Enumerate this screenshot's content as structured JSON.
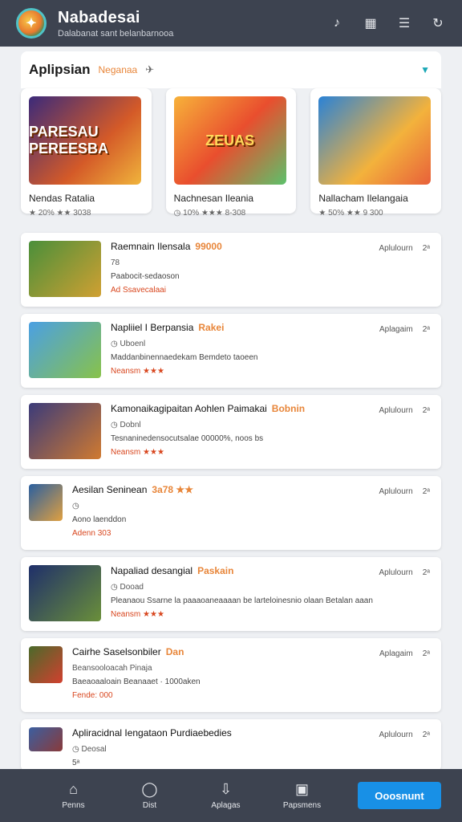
{
  "header": {
    "title": "Nabadesai",
    "subtitle": "Dalabanat sant belanbarnooa",
    "icons": [
      "bell-icon",
      "bookmark-icon",
      "list-icon",
      "refresh-icon"
    ]
  },
  "featured": {
    "title": "Aplipsian",
    "tag": "Neganaa",
    "cards": [
      {
        "art": "PARESAU PEREESBA",
        "name": "Nendas Ratalia",
        "meta": "★ 20% ★★ 3038"
      },
      {
        "art": "ZEUAS",
        "name": "Nachnesan Ileania",
        "meta": "◷ 10% ★★★ 8-308"
      },
      {
        "art": "",
        "name": "Nallacham Ilelangaia",
        "meta": "★ 50% ★★ 9 300"
      }
    ]
  },
  "list": [
    {
      "name": "Raemnain Ilensala",
      "tag": "99000",
      "sub": "78",
      "desc": "Paabocit-sedaoson",
      "rating": "Ad Ssavecalaai",
      "right": "Aplulourn",
      "right2": "2ᵃ"
    },
    {
      "name": "Napliiel I Berpansia",
      "tag": "Rakei",
      "sub": "◷ Uboenl",
      "desc": "Maddanbinennaedekam Bemdeto taoeen",
      "rating": "Neansm ★★★",
      "right": "Aplagaim",
      "right2": "2ᵃ"
    },
    {
      "name": "Kamonaikagipaitan Aohlen Paimakai",
      "tag": "Bobnin",
      "sub": "◷ Dobnl",
      "desc": "Tesnaninedensocutsalae 00000%, noos bs",
      "rating": "Neansm ★★★",
      "right": "Aplulourn",
      "right2": "2ᵃ"
    },
    {
      "name": "Aesilan Seninean",
      "tag": "3a78 ★★",
      "sub": "◷",
      "desc": "Aono laenddon",
      "rating": "Adenn 303",
      "right": "Aplulourn",
      "right2": "2ᵃ"
    },
    {
      "name": "Napaliad desangial",
      "tag": "Paskain",
      "sub": "◷ Dooad",
      "desc": "Pleanaou Ssarne la paaaoaneaaaan be larteloinesnio olaan Betalan aaan",
      "rating": "Neansm ★★★",
      "right": "Aplulourn",
      "right2": "2ᵃ"
    },
    {
      "name": "Cairhe Saselsonbiler",
      "tag": "Dan",
      "sub": "Beansooloacah Pinaja",
      "desc": "Baeaoaaloain Beanaaet · 1000aken",
      "rating": "Fende: 000",
      "right": "Aplagaim",
      "right2": "2ᵃ"
    },
    {
      "name": "Apliracidnal Iengataon Purdiaebedies",
      "tag": "",
      "sub": "◷ Deosal",
      "desc": "5ᵃ",
      "rating": "",
      "right": "Aplulourn",
      "right2": "2ᵃ"
    }
  ],
  "nav": {
    "items": [
      {
        "label": "Penns",
        "icon": "home-icon"
      },
      {
        "label": "Dist",
        "icon": "chat-icon"
      },
      {
        "label": "Aplagas",
        "icon": "download-icon"
      },
      {
        "label": "Papsmens",
        "icon": "image-icon"
      }
    ],
    "primary": "Ooosnunt"
  }
}
